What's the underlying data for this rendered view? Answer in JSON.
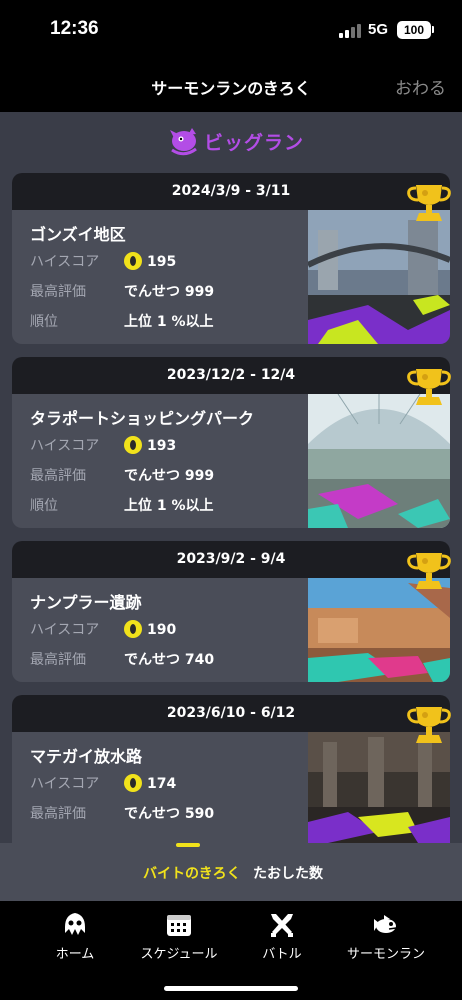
{
  "status_bar": {
    "time": "12:36",
    "network": "5G",
    "battery": "100"
  },
  "nav": {
    "title": "サーモンランのきろく",
    "close": "おわる"
  },
  "mode": {
    "title": "ビッグラン",
    "accent": "#b34de6"
  },
  "cards": [
    {
      "dates": "2024/3/9 - 3/11",
      "stage": "ゴンズイ地区",
      "rows": [
        {
          "label": "ハイスコア",
          "value": "195"
        },
        {
          "label": "最高評価",
          "value": "でんせつ 999"
        },
        {
          "label": "順位",
          "value": "上位 1 %以上"
        }
      ]
    },
    {
      "dates": "2023/12/2 - 12/4",
      "stage": "タラポートショッピングパーク",
      "rows": [
        {
          "label": "ハイスコア",
          "value": "193"
        },
        {
          "label": "最高評価",
          "value": "でんせつ 999"
        },
        {
          "label": "順位",
          "value": "上位 1 %以上"
        }
      ]
    },
    {
      "dates": "2023/9/2 - 9/4",
      "stage": "ナンプラー遺跡",
      "rows": [
        {
          "label": "ハイスコア",
          "value": "190"
        },
        {
          "label": "最高評価",
          "value": "でんせつ 740"
        }
      ]
    },
    {
      "dates": "2023/6/10 - 6/12",
      "stage": "マテガイ放水路",
      "rows": [
        {
          "label": "ハイスコア",
          "value": "174"
        },
        {
          "label": "最高評価",
          "value": "でんせつ 590"
        }
      ]
    }
  ],
  "subtabs": {
    "active": "バイトのきろく",
    "inactive": "たおした数"
  },
  "tabbar": [
    {
      "label": "ホーム",
      "icon": "squid-icon"
    },
    {
      "label": "スケジュール",
      "icon": "calendar-icon"
    },
    {
      "label": "バトル",
      "icon": "crossed-weapons-icon"
    },
    {
      "label": "サーモンラン",
      "icon": "salmon-icon"
    }
  ],
  "colors": {
    "accent_yellow": "#f1e21b",
    "background": "#3a3d48",
    "card": "#4a4d58"
  }
}
